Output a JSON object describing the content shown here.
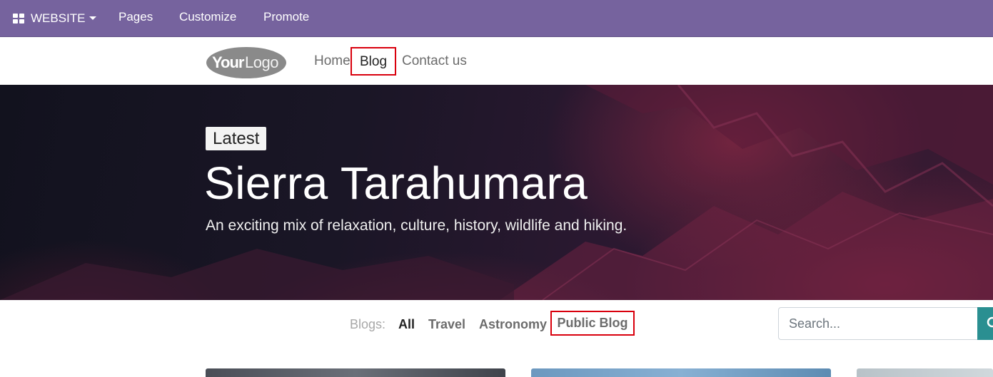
{
  "admin_bar": {
    "website_label": "WEBSITE",
    "pages_label": "Pages",
    "customize_label": "Customize",
    "promote_label": "Promote",
    "background_color": "#76639e"
  },
  "site_header": {
    "logo_text_bold": "Your",
    "logo_text_light": "Logo",
    "nav": {
      "home": "Home",
      "blog": "Blog",
      "contact": "Contact us"
    },
    "highlight_color": "#d9000d"
  },
  "hero": {
    "badge": "Latest",
    "title": "Sierra Tarahumara",
    "subtitle": "An exciting mix of relaxation, culture, history, wildlife and hiking."
  },
  "blog_filters": {
    "label": "Blogs:",
    "items": [
      "All",
      "Travel",
      "Astronomy",
      "Public Blog"
    ],
    "active": "All",
    "highlighted": "Public Blog"
  },
  "search": {
    "placeholder": "Search...",
    "button_color": "#2a8f91"
  }
}
